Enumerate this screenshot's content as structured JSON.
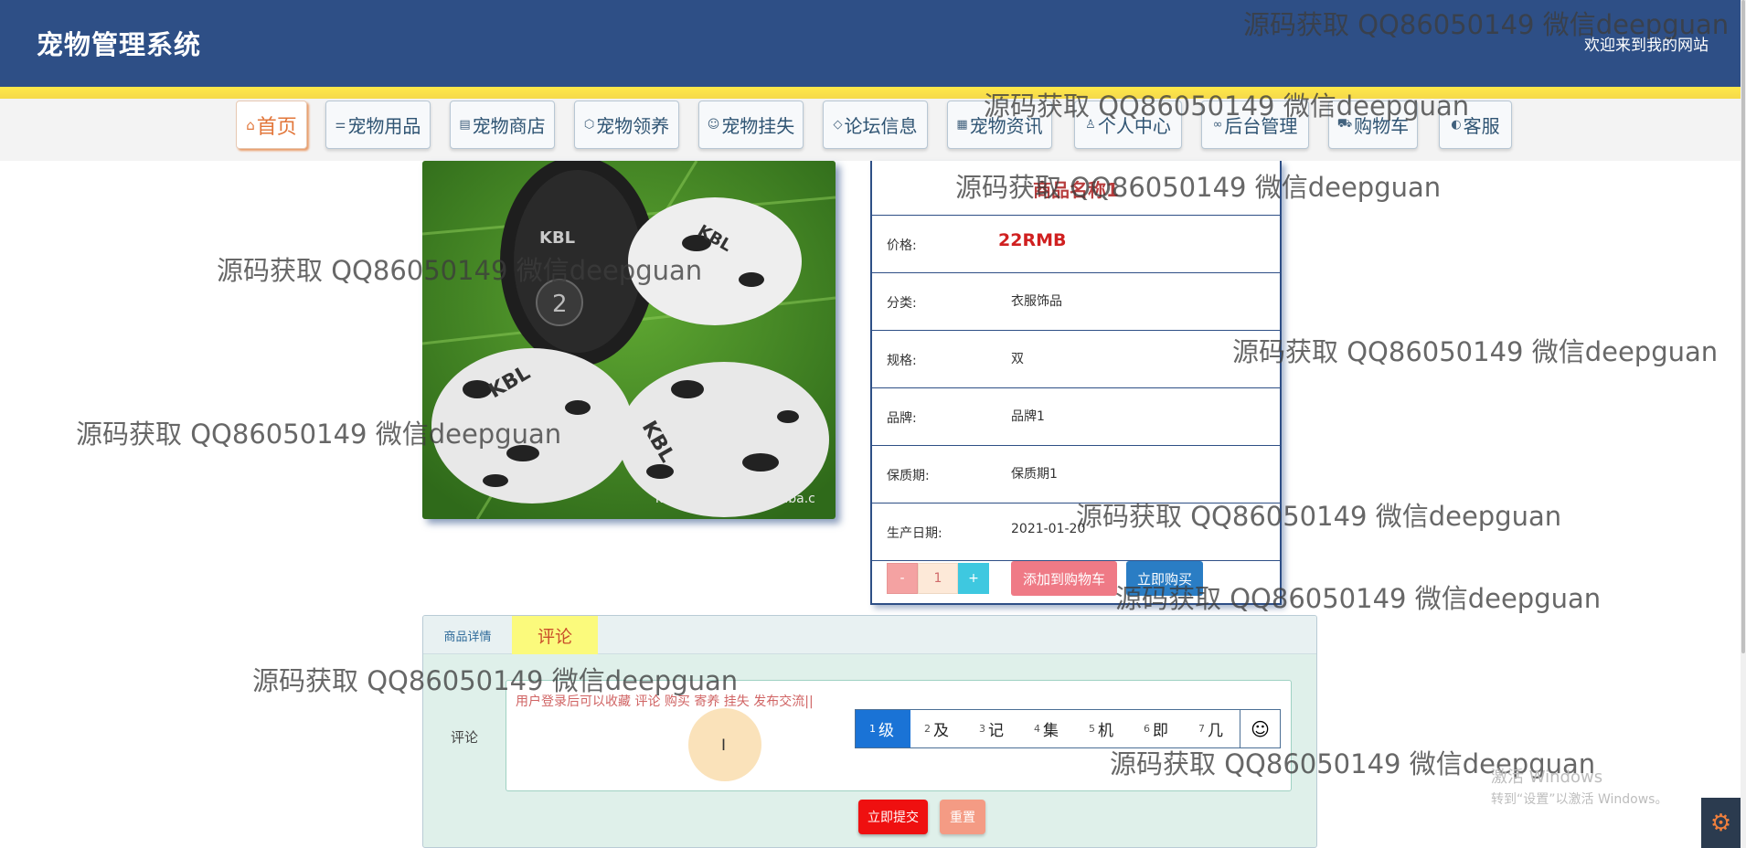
{
  "header": {
    "title": "宠物管理系统",
    "welcome": "欢迎来到我的网站"
  },
  "nav": [
    {
      "icon": "home-icon",
      "glyph": "⌂",
      "label": "首页"
    },
    {
      "icon": "sliders-icon",
      "glyph": "⚌",
      "label": "宠物用品"
    },
    {
      "icon": "shop-icon",
      "glyph": "▤",
      "label": "宠物商店"
    },
    {
      "icon": "box-icon",
      "glyph": "⬡",
      "label": "宠物领养"
    },
    {
      "icon": "smile-icon",
      "glyph": "☺",
      "label": "宠物挂失"
    },
    {
      "icon": "tag-icon",
      "glyph": "◇",
      "label": "论坛信息"
    },
    {
      "icon": "news-icon",
      "glyph": "▦",
      "label": "宠物资讯"
    },
    {
      "icon": "user-icon",
      "glyph": "♙",
      "label": "个人中心"
    },
    {
      "icon": "link-icon",
      "glyph": "∞",
      "label": "后台管理"
    },
    {
      "icon": "cart-icon",
      "glyph": "⛟",
      "label": "购物车"
    },
    {
      "icon": "headset-icon",
      "glyph": "◐",
      "label": "客服"
    }
  ],
  "product": {
    "name": "商品名称1",
    "image_caption": "kabeile1128.cn.alibaba.c",
    "fields": [
      {
        "label": "价格:",
        "value": "22RMB"
      },
      {
        "label": "分类:",
        "value": "衣服饰品"
      },
      {
        "label": "规格:",
        "value": "双"
      },
      {
        "label": "品牌:",
        "value": "品牌1"
      },
      {
        "label": "保质期:",
        "value": "保质期1"
      },
      {
        "label": "生产日期:",
        "value": "2021-01-20"
      }
    ],
    "qty_minus": "-",
    "quantity": "1",
    "qty_plus": "+",
    "add_to_cart": "添加到购物车",
    "buy_now": "立即购买"
  },
  "tabs": {
    "detail": "商品详情",
    "comment": "评论"
  },
  "comment_form": {
    "label": "评论",
    "placeholder": "用户登录后可以收藏  评论  购买 寄养  挂失  发布交流||",
    "submit": "立即提交",
    "reset": "重置"
  },
  "ime": {
    "candidates": [
      {
        "num": "1",
        "text": "级"
      },
      {
        "num": "2",
        "text": "及"
      },
      {
        "num": "3",
        "text": "记"
      },
      {
        "num": "4",
        "text": "集"
      },
      {
        "num": "5",
        "text": "机"
      },
      {
        "num": "6",
        "text": "即"
      },
      {
        "num": "7",
        "text": "几"
      }
    ],
    "emoji": "☺"
  },
  "watermark": "源码获取 QQ86050149 微信deepguan",
  "windows": {
    "line1": "激活 Windows",
    "line2": "转到“设置”以激活 Windows。"
  },
  "colors": {
    "header": "#2e4f86",
    "accent_yellow": "#ffe94a",
    "price": "#d02020",
    "submit": "#ef1010"
  }
}
